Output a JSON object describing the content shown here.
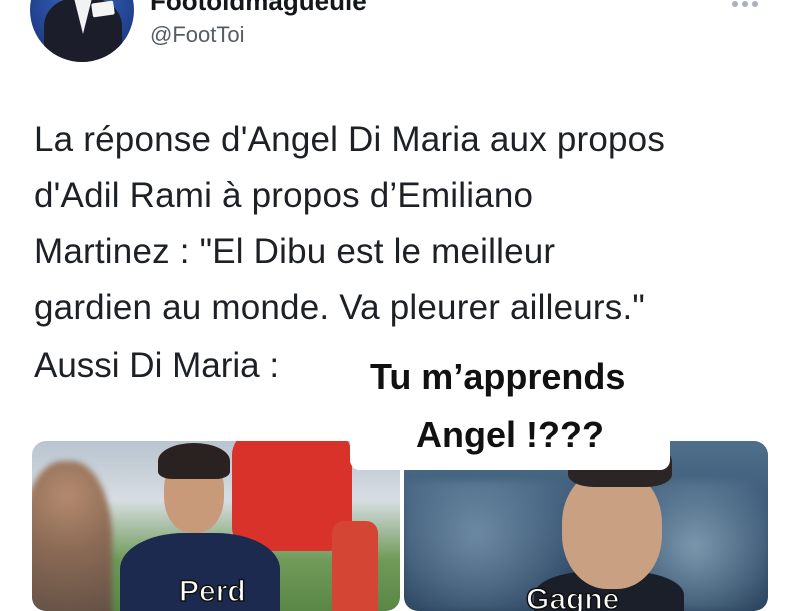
{
  "tweet": {
    "display_name": "Footoidmagueule",
    "handle": "@FootToi",
    "text_lines": [
      "La réponse d'Angel Di Maria aux propos",
      "d'Adil Rami à propos d’Emiliano",
      "Martinez : \"El Dibu est le meilleur",
      "gardien au monde. Va pleurer ailleurs.\""
    ],
    "followup": "Aussi Di Maria :"
  },
  "meme": {
    "caption_line1": "Tu m’apprends",
    "caption_line2": "Angel !???",
    "left_label": "Perd",
    "right_label": "Gagne"
  },
  "colors": {
    "text": "#1d2125",
    "handle": "#555c63",
    "jersey_left": "#1c2a4f",
    "jersey_right": "#1a1f2a",
    "red_kit": "#d8322a"
  }
}
